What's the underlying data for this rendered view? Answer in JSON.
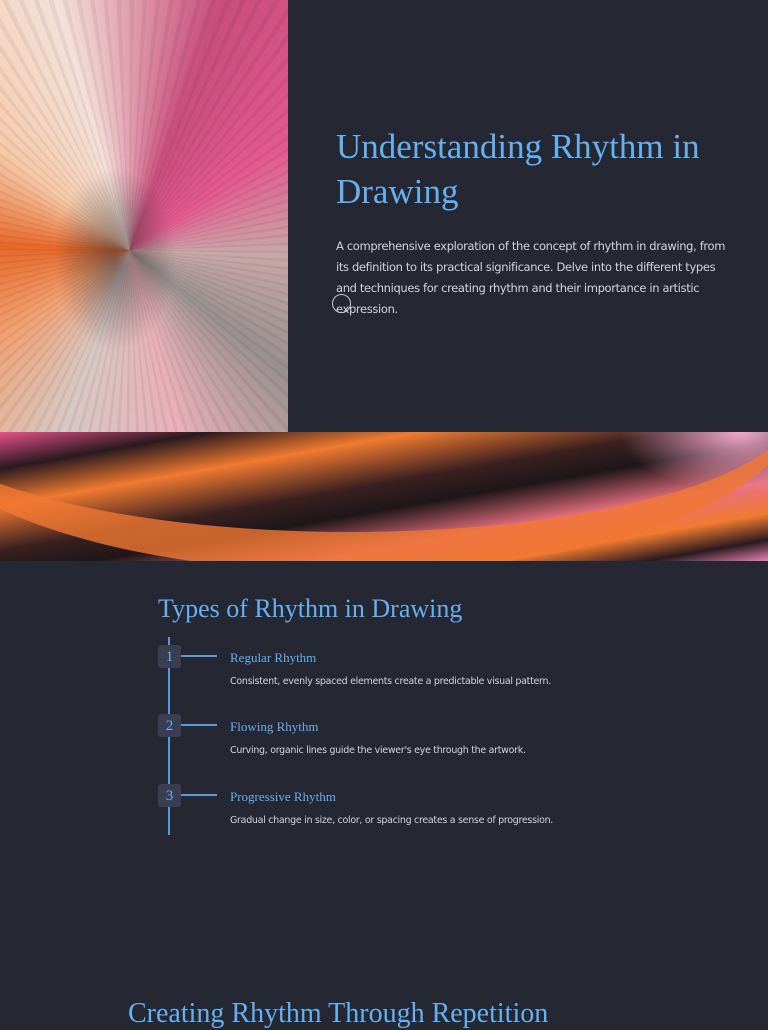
{
  "hero": {
    "title": "Understanding Rhythm in Drawing",
    "description": "A comprehensive exploration of the concept of rhythm in drawing, from its definition to its practical significance. Delve into the different types and techniques for creating rhythm and their importance in artistic expression."
  },
  "types": {
    "heading": "Types of Rhythm in Drawing",
    "items": [
      {
        "number": "1",
        "title": "Regular Rhythm",
        "description": "Consistent, evenly spaced elements create a predictable visual pattern."
      },
      {
        "number": "2",
        "title": "Flowing Rhythm",
        "description": "Curving, organic lines guide the viewer's eye through the artwork."
      },
      {
        "number": "3",
        "title": "Progressive Rhythm",
        "description": "Gradual change in size, color, or spacing creates a sense of progression."
      }
    ]
  },
  "next_section": {
    "heading": "Creating Rhythm Through Repetition"
  },
  "colors": {
    "background": "#252733",
    "accent": "#64b1f2"
  }
}
